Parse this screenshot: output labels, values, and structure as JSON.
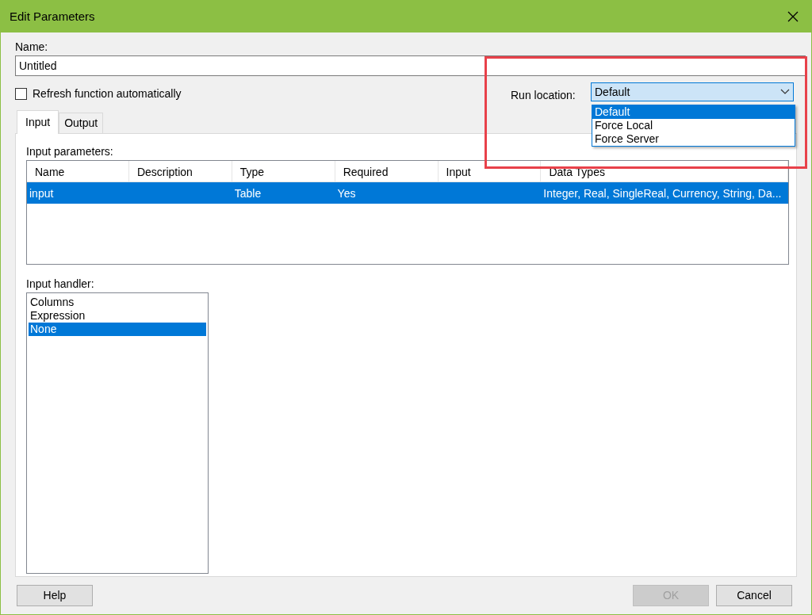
{
  "window": {
    "title": "Edit Parameters"
  },
  "name_field": {
    "label": "Name:",
    "value": "Untitled"
  },
  "refresh_checkbox": {
    "label": "Refresh function automatically",
    "checked": false
  },
  "run_location": {
    "label": "Run location:",
    "value": "Default",
    "expanded": true,
    "options": [
      {
        "label": "Default",
        "selected": true
      },
      {
        "label": "Force Local",
        "selected": false
      },
      {
        "label": "Force Server",
        "selected": false
      }
    ]
  },
  "tabs": [
    {
      "label": "Input",
      "selected": true
    },
    {
      "label": "Output",
      "selected": false
    }
  ],
  "input_parameters": {
    "label": "Input parameters:",
    "columns": [
      "Name",
      "Description",
      "Type",
      "Required",
      "Input",
      "Data Types"
    ],
    "rows": [
      {
        "cells": [
          "input",
          "",
          "Table",
          "Yes",
          "",
          "Integer, Real, SingleReal, Currency, String, Da..."
        ],
        "selected": true
      }
    ]
  },
  "input_handler": {
    "label": "Input handler:",
    "items": [
      {
        "label": "Columns",
        "selected": false
      },
      {
        "label": "Expression",
        "selected": false
      },
      {
        "label": "None",
        "selected": true
      }
    ]
  },
  "buttons": [
    {
      "label": "Help",
      "disabled": false
    },
    {
      "label": "OK",
      "disabled": true
    },
    {
      "label": "Cancel",
      "disabled": false
    }
  ]
}
